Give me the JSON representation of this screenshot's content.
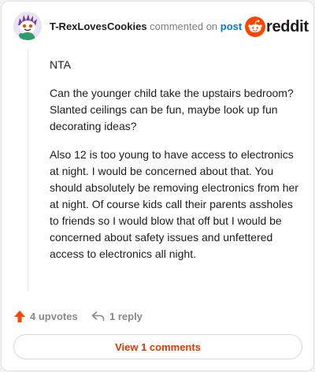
{
  "comment": {
    "author": "T-RexLovesCookies",
    "commented_on_text": "commented on",
    "post_link_text": "post",
    "paragraphs": [
      "NTA",
      "Can the younger child take the upstairs bedroom? Slanted ceilings can be fun, maybe look up fun decorating ideas?",
      "Also 12 is too young to have access to electronics at night. I would be concerned about that. You should absolutely be removing electronics from her at night. Of course kids call their parents assholes to friends so I would blow that off but I would be concerned about safety issues and unfettered access to electronics all night."
    ]
  },
  "brand": {
    "wordmark": "reddit",
    "color": "#ff4500"
  },
  "actions": {
    "upvotes_label": "4 upvotes",
    "reply_label": "1 reply"
  },
  "footer": {
    "view_comments_label": "View 1 comments"
  },
  "colors": {
    "accent_orange": "#ff4500",
    "link_blue": "#0079d3",
    "view_button_text": "#d93a00",
    "muted_gray": "#878a8c"
  },
  "icons": {
    "avatar": "snoo-avatar-icon",
    "logo": "reddit-snoo-icon",
    "upvote": "upvote-arrow-icon",
    "reply": "reply-arrow-icon"
  }
}
